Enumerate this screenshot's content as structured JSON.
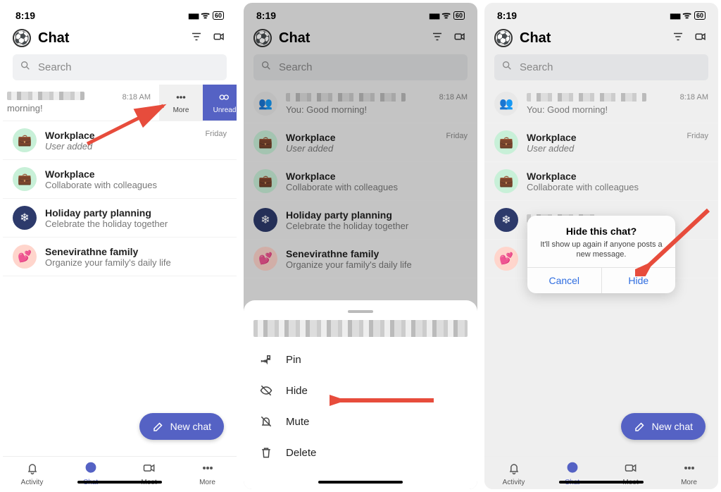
{
  "status": {
    "time": "8:19",
    "battery": "60"
  },
  "header": {
    "title": "Chat"
  },
  "search": {
    "placeholder": "Search"
  },
  "swipe": {
    "more": "More",
    "unread": "Unread"
  },
  "chats": [
    {
      "title_redacted": true,
      "subtitle": "You: Good morning!",
      "subtitle_short": "morning!",
      "time": "8:18 AM"
    },
    {
      "title": "Workplace",
      "subtitle": "User added",
      "time": "Friday",
      "italic": true
    },
    {
      "title": "Workplace",
      "subtitle": "Collaborate with colleagues",
      "time": "",
      "italic": false
    },
    {
      "title": "Holiday party planning",
      "subtitle": "Celebrate the holiday together",
      "time": "",
      "italic": false
    },
    {
      "title": "Senevirathne family",
      "subtitle": "Organize your family's daily life",
      "time": "",
      "italic": false
    }
  ],
  "fab": {
    "label": "New chat"
  },
  "tabs": {
    "activity": "Activity",
    "chat": "Chat",
    "meet": "Meet",
    "more": "More"
  },
  "sheet": {
    "pin": "Pin",
    "hide": "Hide",
    "mute": "Mute",
    "delete": "Delete"
  },
  "dialog": {
    "title": "Hide this chat?",
    "message": "It'll show up again if anyone posts a new message.",
    "cancel": "Cancel",
    "confirm": "Hide"
  }
}
